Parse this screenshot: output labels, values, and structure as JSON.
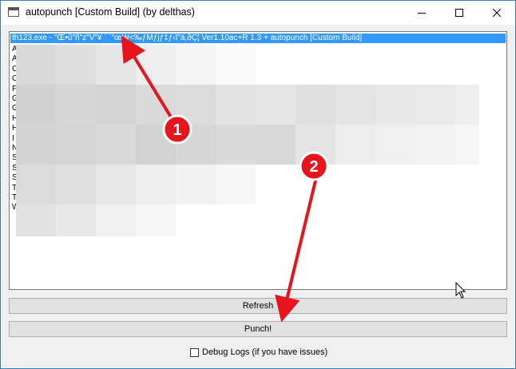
{
  "window": {
    "title": "autopunch [Custom Build] (by delthas)",
    "controls": {
      "minimize": "minimize-icon",
      "maximize": "maximize-icon",
      "close": "close-icon"
    }
  },
  "process_list": {
    "selected_item": "th123.exe - \"Œ•û\"ñ\"z\"V\"¥ ` ´\"œW<‰ƒMƒjƒ‡ƒ‹Ì\"ä,ðÇ¦ Ver1.10ac+R 1.3 + autopunch [Custom Build]",
    "item_initials": [
      "A",
      "A",
      "C",
      "C",
      "F",
      "G",
      "G",
      "H",
      "H",
      "I",
      "N",
      "S",
      "S",
      "S",
      "T",
      "T",
      "W"
    ],
    "selection_color": "#3399ff"
  },
  "buttons": {
    "refresh_label": "Refresh",
    "punch_label": "Punch!"
  },
  "debug": {
    "label": "Debug Logs (if you have issues)",
    "checked": false
  },
  "annotations": {
    "marker1": "1",
    "marker2": "2",
    "color": "#e8141b"
  }
}
